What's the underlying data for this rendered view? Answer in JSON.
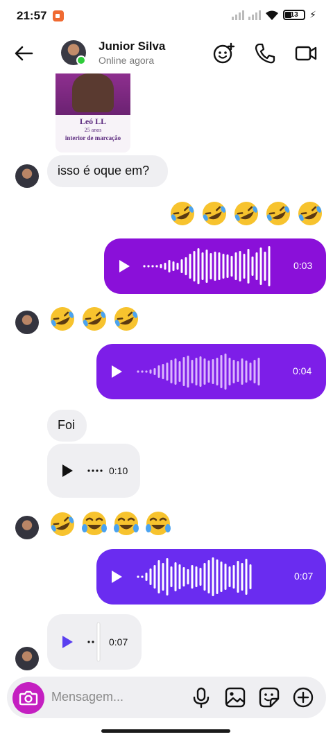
{
  "status_bar": {
    "time": "21:57",
    "battery": "13"
  },
  "header": {
    "name": "Junior Silva",
    "status": "Online agora"
  },
  "media_card": {
    "title": "Leó LL",
    "subtitle": "25 anos",
    "location": "interior de marcação"
  },
  "messages": {
    "text_1": "isso é oque em?",
    "text_2": "Foi"
  },
  "voice": {
    "out_1_duration": "0:03",
    "out_2_duration": "0:04",
    "in_1_duration": "0:10",
    "out_3_duration": "0:07",
    "in_2_duration": "0:07"
  },
  "composer": {
    "placeholder": "Mensagem..."
  },
  "colors": {
    "out_1": "#8a10d9",
    "out_2": "#7d1ee8",
    "out_3": "#6a2cf0",
    "incoming_bg": "#efeff2",
    "camera": "#c41fc1",
    "online": "#2ecc3a"
  },
  "icons": {
    "back": "arrow-left-icon",
    "effects": "sticker-face-icon",
    "call": "phone-icon",
    "video": "video-camera-icon",
    "camera": "camera-icon",
    "mic": "microphone-icon",
    "gallery": "image-icon",
    "sticker": "sticker-icon",
    "add": "plus-circle-icon",
    "emoji_laugh_tilt": "rolling-on-floor-laughing-emoji",
    "emoji_tears": "tears-of-joy-emoji"
  }
}
